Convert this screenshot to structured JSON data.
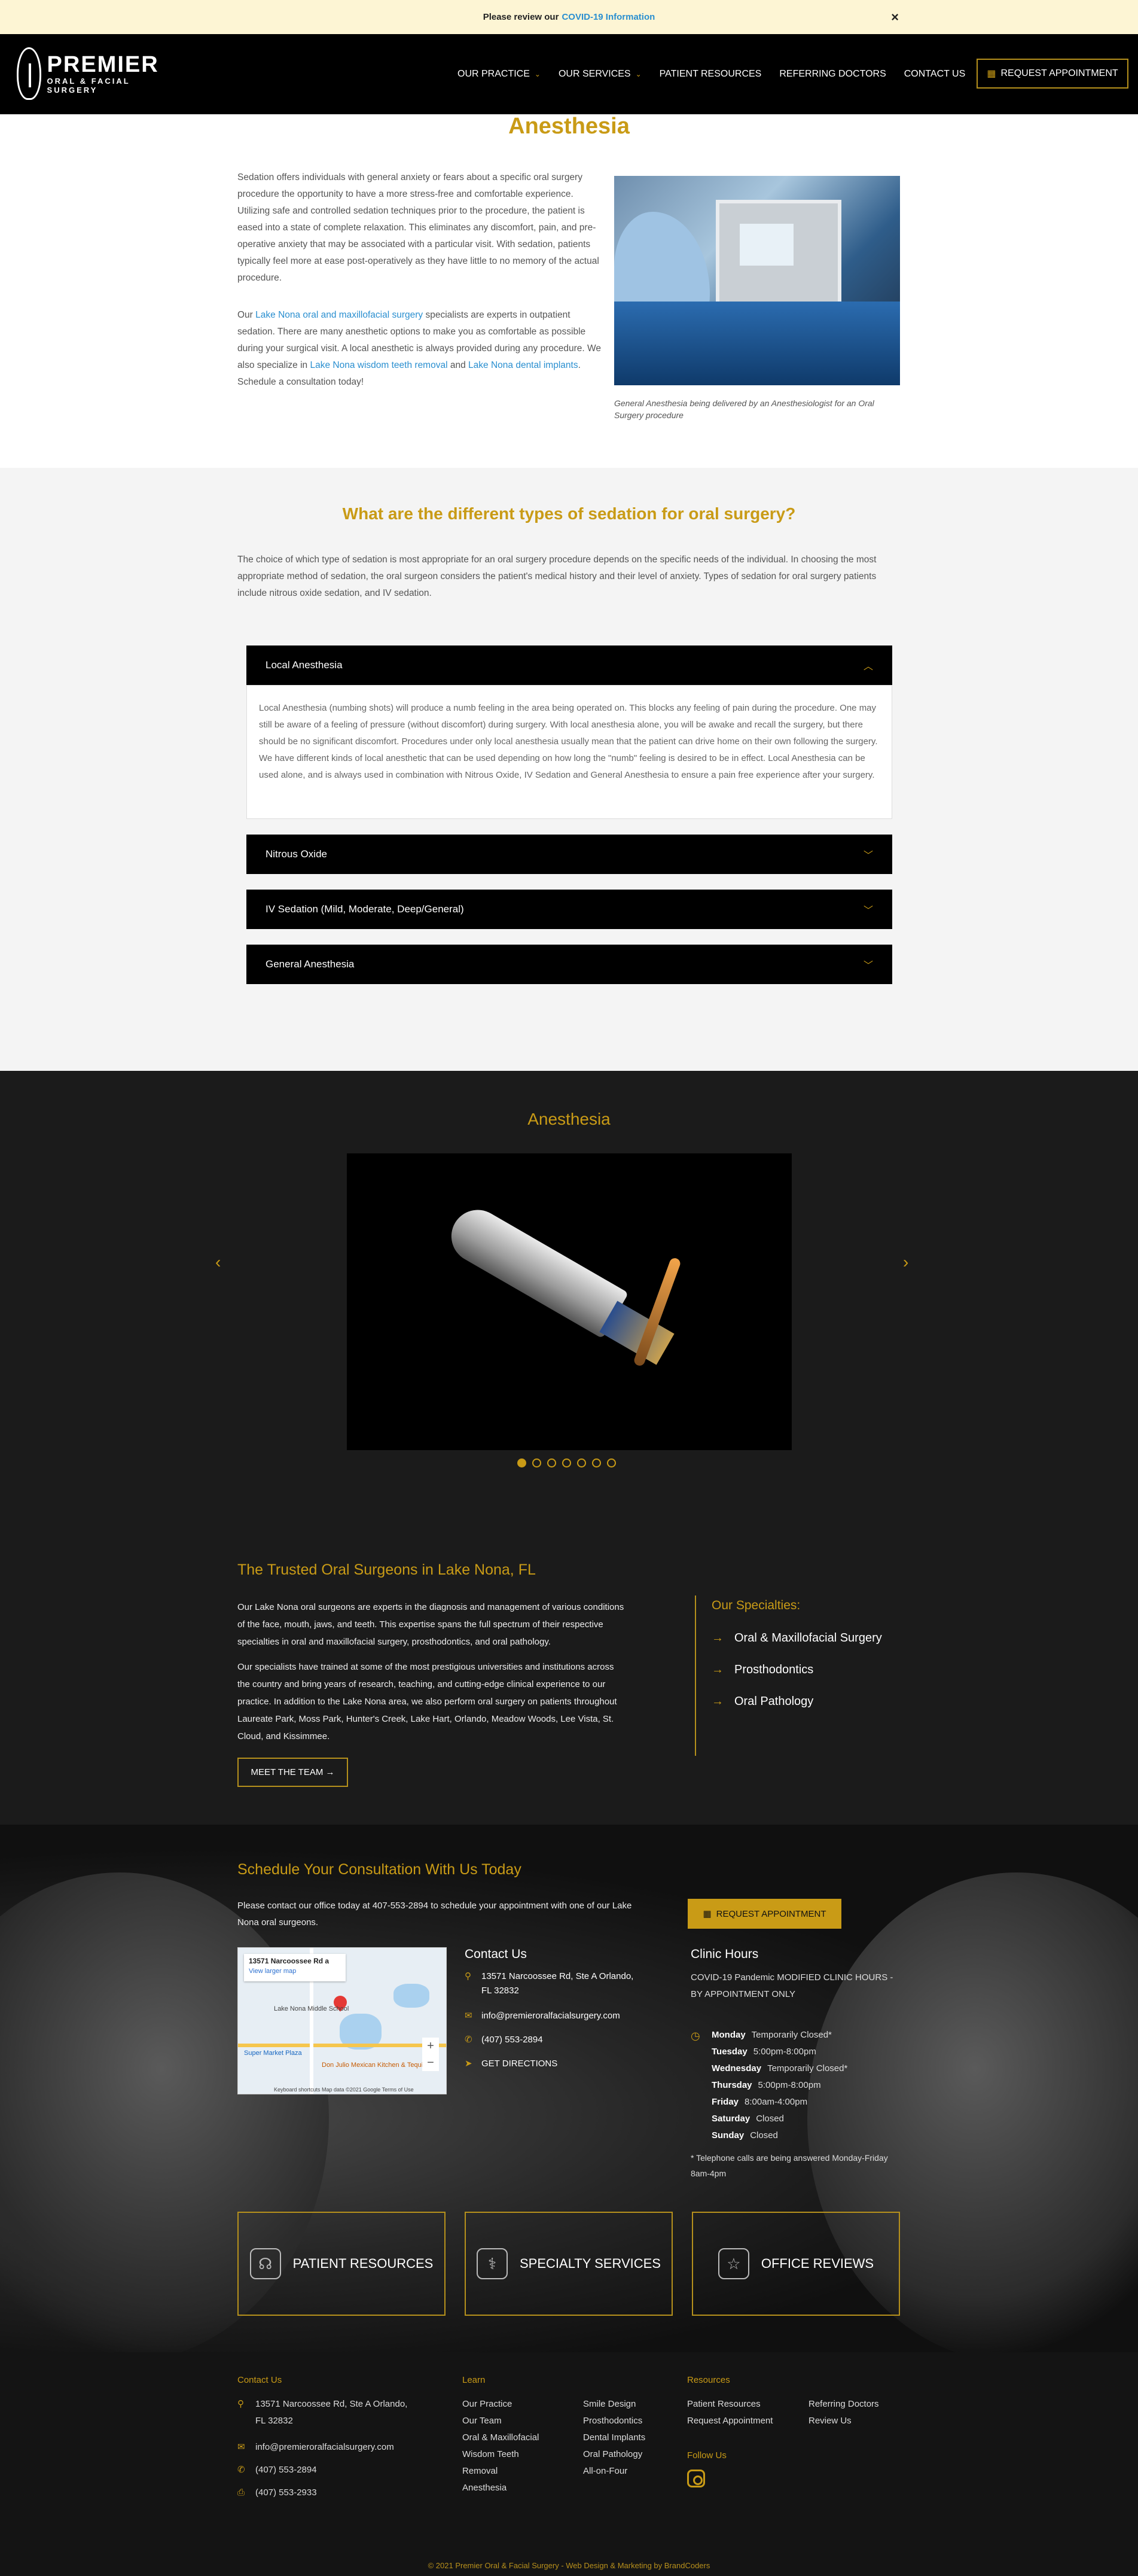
{
  "covid": {
    "text": "Please review our",
    "link": "COVID-19 Information",
    "close": "×"
  },
  "header": {
    "logo_word": "PREMIER",
    "logo_sub": "ORAL & FACIAL SURGERY",
    "nav": [
      "OUR PRACTICE",
      "OUR SERVICES",
      "PATIENT RESOURCES",
      "REFERRING DOCTORS",
      "CONTACT US"
    ],
    "request_button": "REQUEST APPOINTMENT"
  },
  "page_title": "Anesthesia",
  "intro": {
    "p1": "Sedation offers individuals with general anxiety or fears about a specific oral surgery procedure the opportunity to have a more stress-free and comfortable experience. Utilizing safe and controlled sedation techniques prior to the procedure, the patient is eased into a state of complete relaxation. This eliminates any discomfort, pain, and pre-operative anxiety that may be associated with a particular visit. With sedation, patients typically feel more at ease post-operatively as they have little to no memory of the actual procedure.",
    "p2_a": "Our",
    "p2_link1": "Lake Nona oral and maxillofacial surgery",
    "p2_b": "specialists are experts in outpatient sedation. There are many anesthetic options to make you as comfortable as possible during your surgical visit. A local anesthetic is always provided during any procedure. We also specialize in",
    "p2_link2": "Lake Nona wisdom teeth removal",
    "p2_c": "and",
    "p2_link3": "Lake Nona dental implants",
    "p2_d": ". Schedule a consultation today!",
    "caption": "General Anesthesia being delivered by an Anesthesiologist for an Oral Surgery procedure"
  },
  "types": {
    "heading": "What are the different types of sedation for oral surgery?",
    "text": "The choice of which type of sedation is most appropriate for an oral surgery procedure depends on the specific needs of the individual. In choosing the most appropriate method of sedation, the oral surgeon considers the patient's medical history and their level of anxiety. Types of sedation for oral surgery patients include nitrous oxide sedation, and IV sedation.",
    "accordion": [
      {
        "title": "Local Anesthesia",
        "body": "Local Anesthesia (numbing shots) will produce a numb feeling in the area being operated on. This blocks any feeling of pain during the procedure. One may still be aware of a feeling of pressure (without discomfort) during surgery. With local anesthesia alone, you will be awake and recall the surgery, but there should be no significant discomfort. Procedures under only local anesthesia usually mean that the patient can drive home on their own following the surgery. We have different kinds of local anesthetic that can be used depending on how long the \"numb\" feeling is desired to be in effect. Local Anesthesia can be used alone, and is always used in combination with Nitrous Oxide, IV Sedation and General Anesthesia to ensure a pain free experience after your surgery."
      },
      {
        "title": "Nitrous Oxide"
      },
      {
        "title": "IV Sedation (Mild, Moderate, Deep/General)"
      },
      {
        "title": "General Anesthesia"
      }
    ]
  },
  "gallery": {
    "heading": "Anesthesia",
    "slide_count": 7,
    "active_index": 0,
    "prev": "‹",
    "next": "›"
  },
  "trusted": {
    "heading": "The Trusted Oral Surgeons in Lake Nona, FL",
    "p1": "Our Lake Nona oral surgeons are experts in the diagnosis and management of various conditions of the face, mouth, jaws, and teeth. This expertise spans the full spectrum of their respective specialties in oral and maxillofacial surgery, prosthodontics, and oral pathology.",
    "p2": "Our specialists have trained at some of the most prestigious universities and institutions across the country and bring years of research, teaching, and cutting-edge clinical experience to our practice. In addition to the Lake Nona area, we also perform oral surgery on patients throughout Laureate Park, Moss Park, Hunter's Creek, Lake Hart, Orlando, Meadow Woods, Lee Vista, St. Cloud, and Kissimmee.",
    "team_button": "MEET THE TEAM →",
    "spec_heading": "Our Specialties:",
    "specialties": [
      "Oral & Maxillofacial Surgery",
      "Prosthodontics",
      "Oral Pathology"
    ]
  },
  "schedule": {
    "heading": "Schedule Your Consultation With Us Today",
    "text": "Please contact our office today at 407-553-2894 to schedule your appointment with one of our Lake Nona oral surgeons.",
    "button": "REQUEST APPOINTMENT",
    "map": {
      "title": "13571 Narcoossee Rd a",
      "view": "View larger map",
      "label1": "Lake Nona Middle School",
      "label2": "Super Market Plaza",
      "label3": "Don Julio Mexican Kitchen & Tequila",
      "footer": "Keyboard shortcuts  Map data ©2021 Google  Terms of Use"
    },
    "contact_heading": "Contact Us",
    "address": "13571 Narcoossee Rd, Ste A Orlando, FL 32832",
    "email": "info@premieroralfacialsurgery.com",
    "phone": "(407) 553-2894",
    "directions": "GET DIRECTIONS",
    "hours_heading": "Clinic Hours",
    "hours_sub": "COVID-19 Pandemic MODIFIED CLINIC HOURS - BY APPOINTMENT ONLY",
    "hours": [
      {
        "day": "Monday",
        "time": "Temporarily Closed*"
      },
      {
        "day": "Tuesday",
        "time": "5:00pm-8:00pm"
      },
      {
        "day": "Wednesday",
        "time": "Temporarily Closed*"
      },
      {
        "day": "Thursday",
        "time": "5:00pm-8:00pm"
      },
      {
        "day": "Friday",
        "time": "8:00am-4:00pm"
      },
      {
        "day": "Saturday",
        "time": "Closed"
      },
      {
        "day": "Sunday",
        "time": "Closed"
      }
    ],
    "hours_note": "* Telephone calls are being answered Monday-Friday 8am-4pm",
    "big_buttons": [
      "PATIENT RESOURCES",
      "SPECIALTY SERVICES",
      "OFFICE REVIEWS"
    ]
  },
  "footer": {
    "contact_heading": "Contact Us",
    "address": "13571 Narcoossee Rd, Ste A Orlando, FL 32832",
    "email": "info@premieroralfacialsurgery.com",
    "phone1": "(407) 553-2894",
    "phone2": "(407) 553-2933",
    "learn_heading": "Learn",
    "learn_col1": [
      "Our Practice",
      "Our Team",
      "Oral & Maxillofacial",
      "Wisdom Teeth",
      "Removal",
      "Anesthesia"
    ],
    "learn_col2": [
      "Smile Design",
      "Prosthodontics",
      "Dental Implants",
      "Oral Pathology",
      "All-on-Four"
    ],
    "resources_heading": "Resources",
    "res_col1": [
      "Patient Resources",
      "Request Appointment"
    ],
    "res_col2": [
      "Referring Doctors",
      "Review Us"
    ],
    "follow_heading": "Follow Us",
    "copyright": "© 2021 Premier Oral & Facial Surgery - Web Design & Marketing by BrandCoders"
  },
  "colors": {
    "gold": "#c99b16",
    "link": "#2a8fd0",
    "dark": "#1b1b1b",
    "black": "#000000"
  }
}
